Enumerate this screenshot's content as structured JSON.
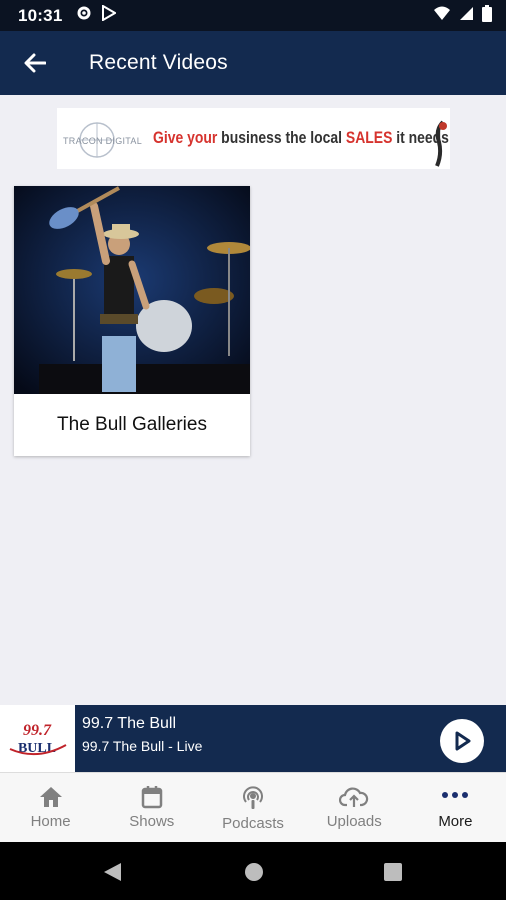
{
  "status_bar": {
    "time": "10:31",
    "icons": [
      "settings-icon",
      "play-store-icon",
      "wifi-icon",
      "signal-icon",
      "battery-icon"
    ]
  },
  "app_bar": {
    "back_icon": "arrow-left-icon",
    "title": "Recent Videos"
  },
  "banner": {
    "logo_text": "TRACON DIGITAL",
    "slogan_parts": [
      {
        "text": "Give your",
        "color": "#d6332e"
      },
      {
        "text": " business the local ",
        "color": "#333333"
      },
      {
        "text": "SALES",
        "color": "#d6332e"
      },
      {
        "text": " it needs",
        "color": "#333333"
      }
    ]
  },
  "gallery": {
    "items": [
      {
        "label": "The Bull Galleries",
        "image": "concert-photo"
      }
    ]
  },
  "player": {
    "logo_alt": "99.7 The Bull logo",
    "station_name": "99.7 The Bull",
    "stream_name": "99.7 The Bull - Live",
    "play_icon": "play-icon"
  },
  "bottom_nav": {
    "items": [
      {
        "label": "Home",
        "icon": "home-icon",
        "active": false
      },
      {
        "label": "Shows",
        "icon": "calendar-icon",
        "active": false
      },
      {
        "label": "Podcasts",
        "icon": "podcast-icon",
        "active": false
      },
      {
        "label": "Uploads",
        "icon": "cloud-upload-icon",
        "active": false
      },
      {
        "label": "More",
        "icon": "more-icon",
        "active": true
      }
    ]
  },
  "colors": {
    "app_bar": "#132a4f",
    "status_bar": "#0b1322",
    "background": "#efeff4",
    "accent_red": "#d6332e"
  }
}
